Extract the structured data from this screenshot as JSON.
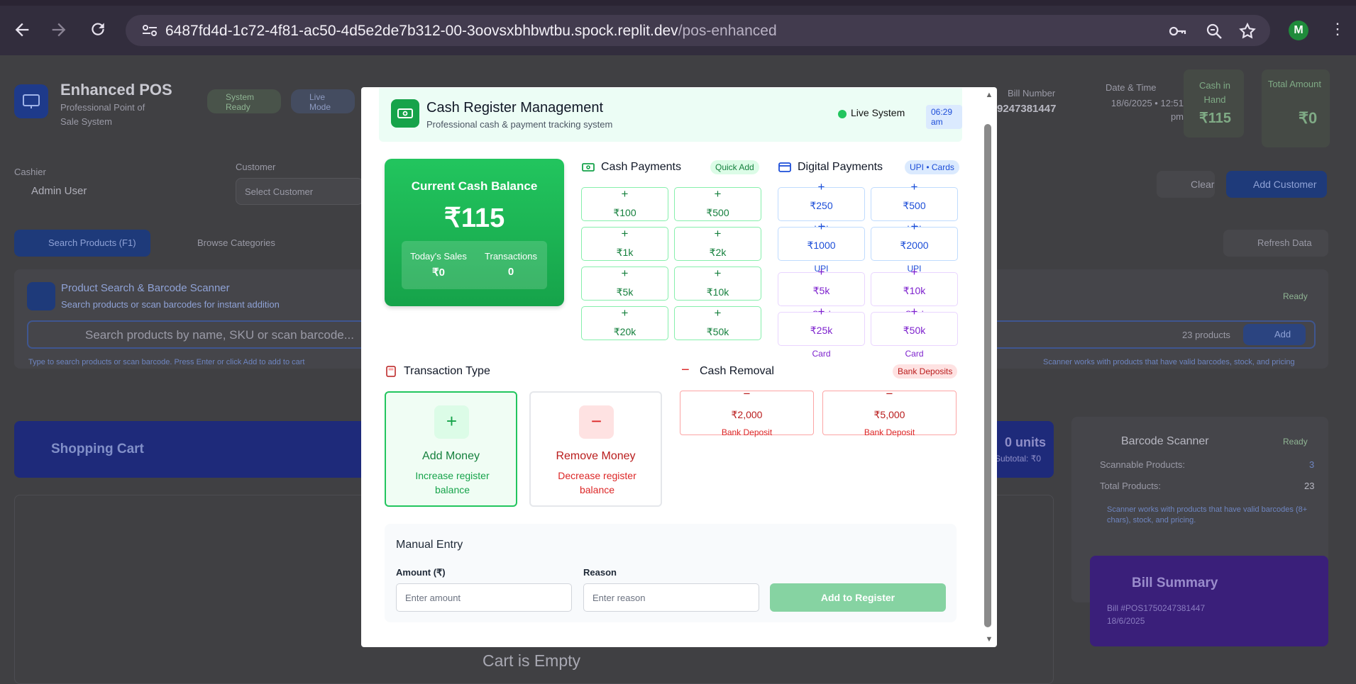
{
  "browser": {
    "url_host": "6487fd4d-1c72-4f81-ac50-4d5e2de7b312-00-3oovsxbhbwtbu.spock.replit.dev",
    "url_path": "/pos-enhanced",
    "profile_initial": "M"
  },
  "app": {
    "title": "Enhanced POS",
    "subtitle": "Professional Point of Sale System",
    "status_ready": "System Ready",
    "status_live": "Live Mode",
    "bill_number_label": "Bill Number",
    "bill_number": "9247381447",
    "datetime_label": "Date & Time",
    "datetime_value": "18/6/2025 • 12:51 pm",
    "cash_in_hand_label": "Cash in Hand",
    "cash_in_hand_value": "₹115",
    "total_amount_label": "Total Amount",
    "total_amount_value": "₹0",
    "cashier_label": "Cashier",
    "cashier_name": "Admin User",
    "customer_label": "Customer",
    "customer_placeholder": "Select Customer",
    "clear_label": "Clear",
    "add_customer_label": "Add Customer",
    "tab_search": "Search Products (F1)",
    "tab_browse": "Browse Categories",
    "refresh_label": "Refresh Data",
    "search_title": "Product Search & Barcode Scanner",
    "search_sub": "Search products or scan barcodes for instant addition",
    "search_ready": "Ready",
    "search_placeholder": "Search products by name, SKU or scan barcode...",
    "products_count": "23 products",
    "search_add": "Add",
    "hint_left": "Type to search products or scan barcode. Press Enter or click Add to add to cart",
    "hint_right": "Scanner works with products that have valid barcodes, stock, and pricing",
    "cart_title": "Shopping Cart",
    "cart_units": "0 units",
    "cart_subtotal": "Subtotal: ₹0",
    "cart_empty": "Cart is Empty",
    "scanner_title": "Barcode Scanner",
    "scanner_ready": "Ready",
    "scannable_label": "Scannable Products:",
    "scannable_value": "3",
    "total_products_label": "Total Products:",
    "total_products_value": "23",
    "scanner_note": "Scanner works with products that have valid barcodes (8+ chars), stock, and pricing.",
    "bill_summary_title": "Bill Summary",
    "bill_summary_no": "Bill #POS1750247381447",
    "bill_summary_date": "18/6/2025"
  },
  "modal": {
    "title": "Cash Register Management",
    "subtitle": "Professional cash & payment tracking system",
    "live_label": "Live System",
    "time": "06:29 am",
    "balance_label": "Current Cash Balance",
    "balance_value": "₹115",
    "todays_sales_label": "Today's Sales",
    "todays_sales_value": "₹0",
    "transactions_label": "Transactions",
    "transactions_value": "0",
    "cash_payments_title": "Cash Payments",
    "cash_payments_badge": "Quick Add",
    "cash_buttons": [
      "₹100",
      "₹500",
      "₹1k",
      "₹2k",
      "₹5k",
      "₹10k",
      "₹20k",
      "₹50k"
    ],
    "digital_title": "Digital Payments",
    "digital_badge": "UPI • Cards",
    "digital_buttons": [
      {
        "value": "₹250",
        "kind": "UPI"
      },
      {
        "value": "₹500",
        "kind": "UPI"
      },
      {
        "value": "₹1000",
        "kind": "UPI"
      },
      {
        "value": "₹2000",
        "kind": "UPI"
      },
      {
        "value": "₹5k",
        "kind": "Card"
      },
      {
        "value": "₹10k",
        "kind": "Card"
      },
      {
        "value": "₹25k",
        "kind": "Card"
      },
      {
        "value": "₹50k",
        "kind": "Card"
      }
    ],
    "transaction_type_title": "Transaction Type",
    "add_money_label": "Add Money",
    "add_money_desc": "Increase register balance",
    "remove_money_label": "Remove Money",
    "remove_money_desc": "Decrease register balance",
    "cash_removal_title": "Cash Removal",
    "cash_removal_badge": "Bank Deposits",
    "removal_buttons": [
      {
        "value": "₹2,000",
        "kind": "Bank Deposit"
      },
      {
        "value": "₹5,000",
        "kind": "Bank Deposit"
      }
    ],
    "manual_title": "Manual Entry",
    "amount_label": "Amount (₹)",
    "amount_placeholder": "Enter amount",
    "reason_label": "Reason",
    "reason_placeholder": "Enter reason",
    "add_to_register": "Add to Register"
  },
  "colors": {
    "green": "#16a34a",
    "blue": "#1d4ed8",
    "purple": "#7e22ce",
    "red": "#dc2626"
  }
}
